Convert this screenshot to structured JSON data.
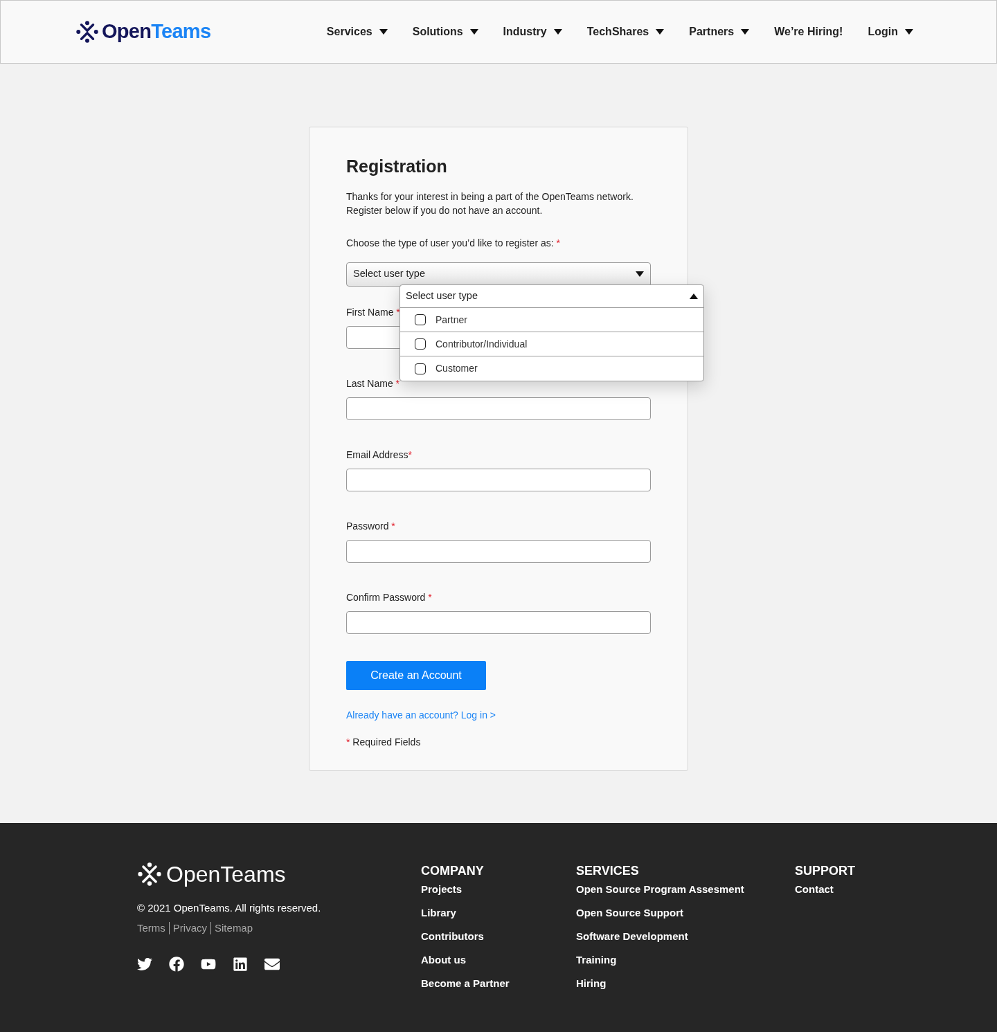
{
  "header": {
    "logo": {
      "part1": "Open",
      "part2": "Teams"
    },
    "nav": [
      {
        "label": "Services",
        "has_menu": true
      },
      {
        "label": "Solutions",
        "has_menu": true
      },
      {
        "label": "Industry",
        "has_menu": true
      },
      {
        "label": "TechShares",
        "has_menu": true
      },
      {
        "label": "Partners",
        "has_menu": true
      },
      {
        "label": "We’re Hiring!",
        "has_menu": false
      },
      {
        "label": "Login",
        "has_menu": true
      }
    ]
  },
  "form": {
    "title": "Registration",
    "intro": "Thanks for your interest in being a part of the OpenTeams network. Register below if you do not have an account.",
    "user_type_label": "Choose the type of user you’d like to register as:",
    "user_type_mark": "*",
    "select": {
      "value": "Select user type",
      "expanded": true,
      "dropdown_header": "Select user type",
      "options": [
        {
          "label": "Partner",
          "checked": false
        },
        {
          "label": "Contributor/Individual",
          "checked": false
        },
        {
          "label": "Customer",
          "checked": false
        }
      ]
    },
    "fields": [
      {
        "label": "First Name",
        "mark": "*"
      },
      {
        "label": "Last Name",
        "mark": "*"
      },
      {
        "label": "Email Address",
        "mark": "*"
      },
      {
        "label": "Password",
        "mark": "*"
      },
      {
        "label": "Confirm Password",
        "mark": "*"
      }
    ],
    "submit": "Create an Account",
    "login_link": "Already have an account? Log in >",
    "required_note_mark": "*",
    "required_note": "Required Fields"
  },
  "footer": {
    "logo": "OpenTeams",
    "copyright": "© 2021 OpenTeams. All rights reserved.",
    "legal_links": [
      "Terms",
      "Privacy",
      "Sitemap"
    ],
    "social": [
      {
        "kind": "twitter"
      },
      {
        "kind": "facebook"
      },
      {
        "kind": "youtube"
      },
      {
        "kind": "linkedin"
      },
      {
        "kind": "email"
      }
    ],
    "columns": [
      {
        "heading": "COMPANY",
        "links": [
          "Projects",
          "Library",
          "Contributors",
          "About us",
          "Become a Partner"
        ]
      },
      {
        "heading": "SERVICES",
        "links": [
          "Open Source Program Assesment",
          "Open Source Support",
          "Software Development",
          "Training",
          "Hiring"
        ]
      },
      {
        "heading": "SUPPORT",
        "links": [
          "Contact"
        ]
      }
    ]
  }
}
